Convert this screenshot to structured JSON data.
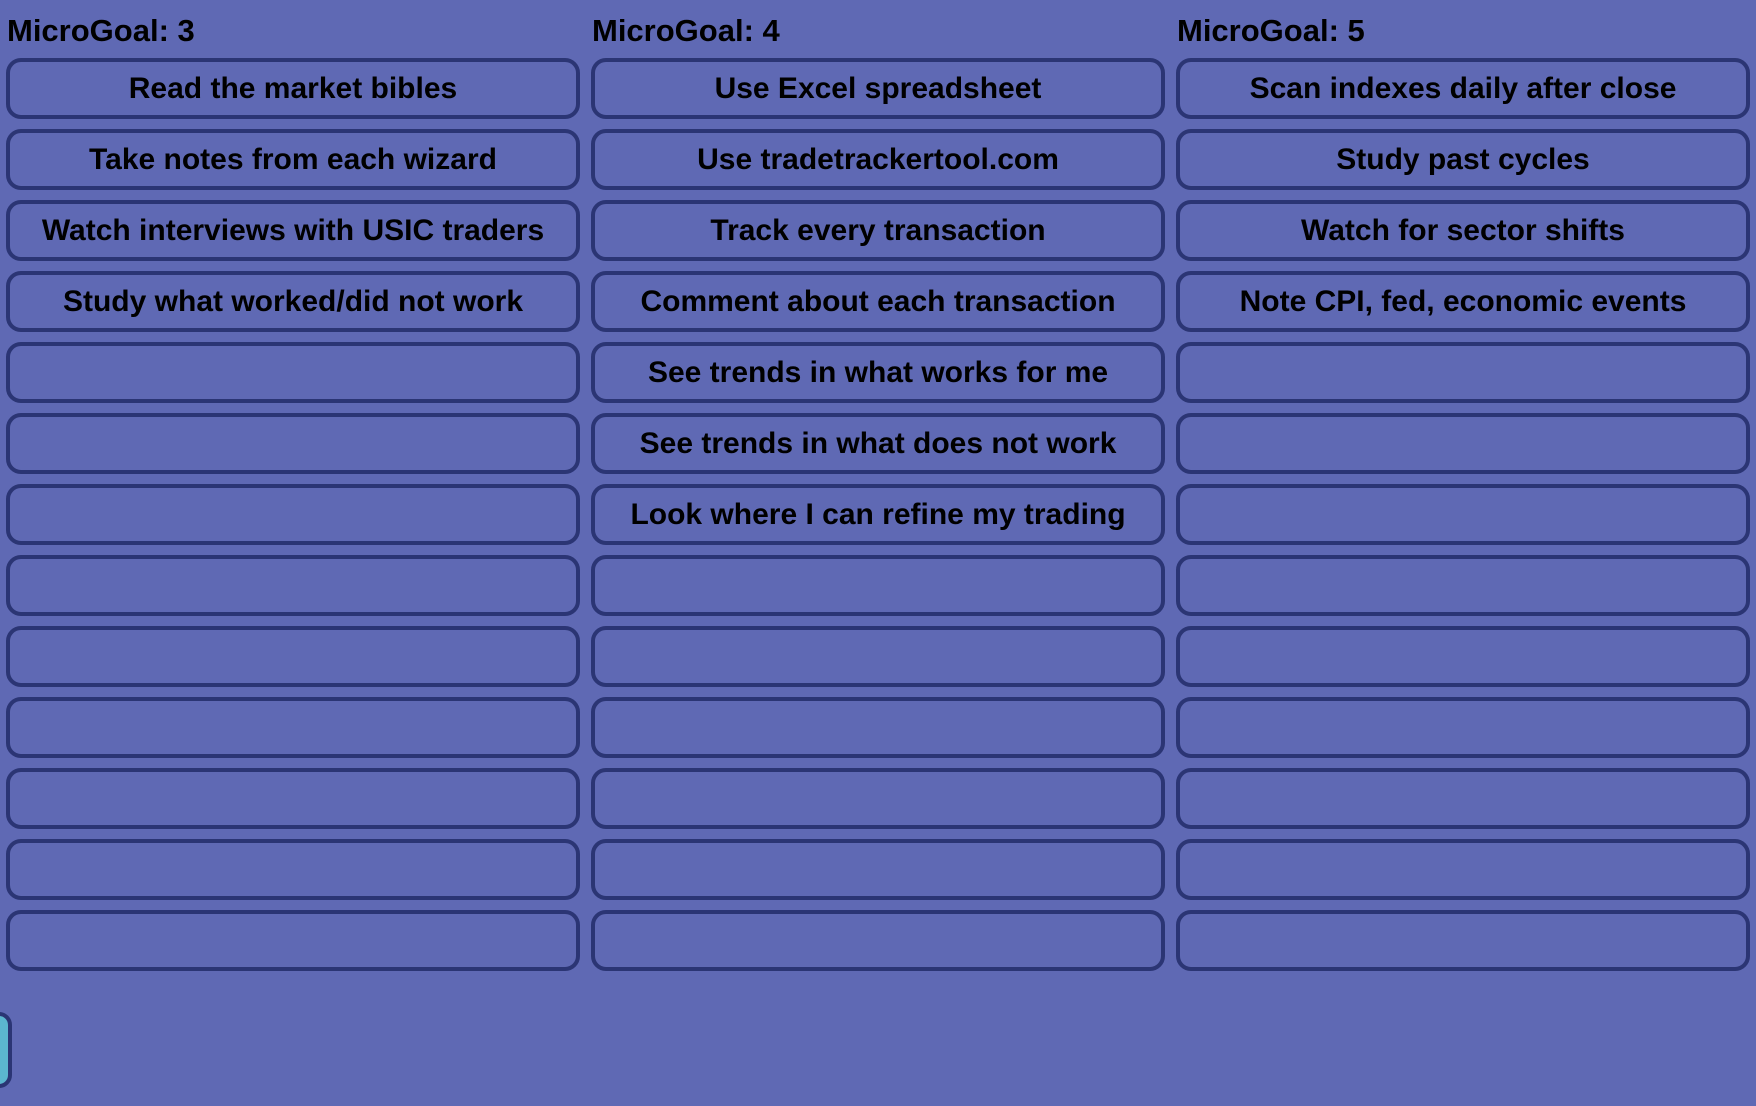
{
  "columns": [
    {
      "title": "MicroGoal: 3",
      "items": [
        "Read the market bibles",
        "Take notes from each wizard",
        "Watch interviews with USIC traders",
        "Study what worked/did not work",
        "",
        "",
        "",
        "",
        "",
        "",
        "",
        "",
        ""
      ]
    },
    {
      "title": "MicroGoal: 4",
      "items": [
        "Use Excel spreadsheet",
        "Use tradetrackertool.com",
        "Track every transaction",
        "Comment about each transaction",
        "See trends in what works for me",
        "See trends in what does not work",
        "Look where I can refine my trading",
        "",
        "",
        "",
        "",
        "",
        ""
      ]
    },
    {
      "title": "MicroGoal: 5",
      "items": [
        "Scan indexes daily after close",
        "Study past cycles",
        "Watch for sector shifts",
        "Note CPI, fed, economic events",
        "",
        "",
        "",
        "",
        "",
        "",
        "",
        "",
        ""
      ]
    }
  ],
  "colors": {
    "background": "#5f69b4",
    "slot_border": "#2b3574",
    "side_tab": "#5bb6cf"
  }
}
